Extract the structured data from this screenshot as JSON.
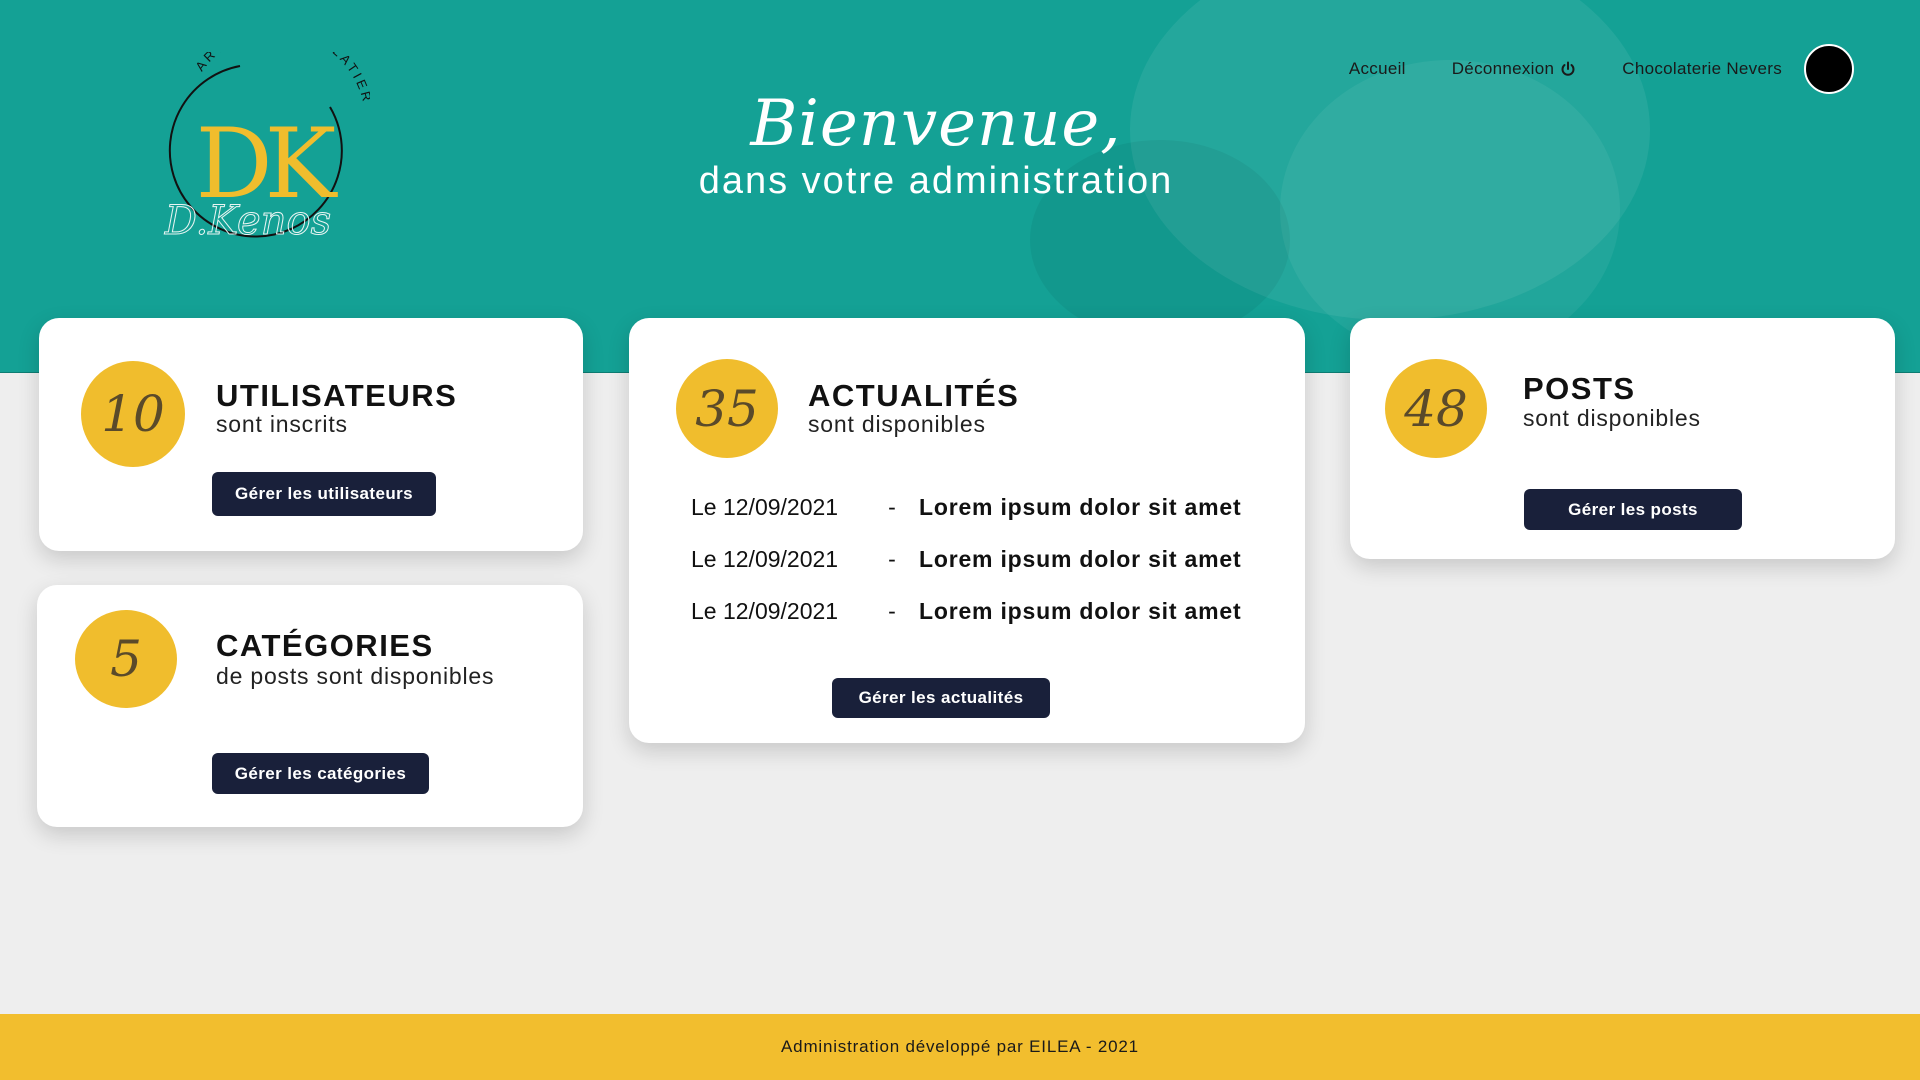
{
  "header": {
    "logo": {
      "monogram": "DK",
      "ring_text": "ARTISAN CHOCOLATIER",
      "signature": "D.Kenos"
    },
    "welcome_title": "Bienvenue,",
    "welcome_subtitle": "dans votre administration",
    "nav": {
      "home_label": "Accueil",
      "logout_label": "Déconnexion",
      "logout_icon": "power-icon",
      "shop_label": "Chocolaterie Nevers",
      "avatar_icon": "avatar"
    }
  },
  "cards": {
    "users": {
      "count": "10",
      "title": "UTILISATEURS",
      "subtitle": "sont inscrits",
      "button": "Gérer les utilisateurs"
    },
    "categories": {
      "count": "5",
      "title": "CATÉGORIES",
      "subtitle": "de posts sont disponibles",
      "button": "Gérer les catégories"
    },
    "news": {
      "count": "35",
      "title": "ACTUALITÉS",
      "subtitle": "sont disponibles",
      "button": "Gérer les actualités",
      "items": [
        {
          "date": "Le 12/09/2021",
          "sep": "-",
          "title": "Lorem ipsum dolor sit amet"
        },
        {
          "date": "Le 12/09/2021",
          "sep": "-",
          "title": "Lorem ipsum dolor sit amet"
        },
        {
          "date": "Le 12/09/2021",
          "sep": "-",
          "title": "Lorem ipsum dolor sit amet"
        }
      ]
    },
    "posts": {
      "count": "48",
      "title": "POSTS",
      "subtitle": "sont disponibles",
      "button": "Gérer les posts"
    }
  },
  "footer": {
    "text": "Administration développé par EILEA - 2021"
  },
  "colors": {
    "teal": "#14a195",
    "gold": "#f0bd2d",
    "navy": "#19203a",
    "page_bg": "#eeeeee"
  }
}
